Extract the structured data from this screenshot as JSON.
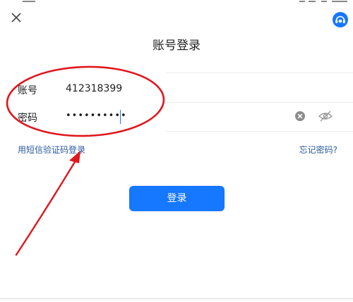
{
  "header": {
    "title": "账号登录"
  },
  "form": {
    "account_label": "账号",
    "account_value": "412318399",
    "password_label": "密码",
    "password_value": "••••••••••"
  },
  "links": {
    "sms_login": "用短信验证码登录",
    "forgot_password": "忘记密码?"
  },
  "actions": {
    "login_label": "登录"
  },
  "icons": {
    "close": "close-icon",
    "service": "customer-service-icon",
    "clear": "clear-circle-icon",
    "visibility": "eye-off-icon"
  },
  "colors": {
    "primary": "#1677ff",
    "link": "#2b5a9e",
    "annotation": "#e0171d"
  }
}
